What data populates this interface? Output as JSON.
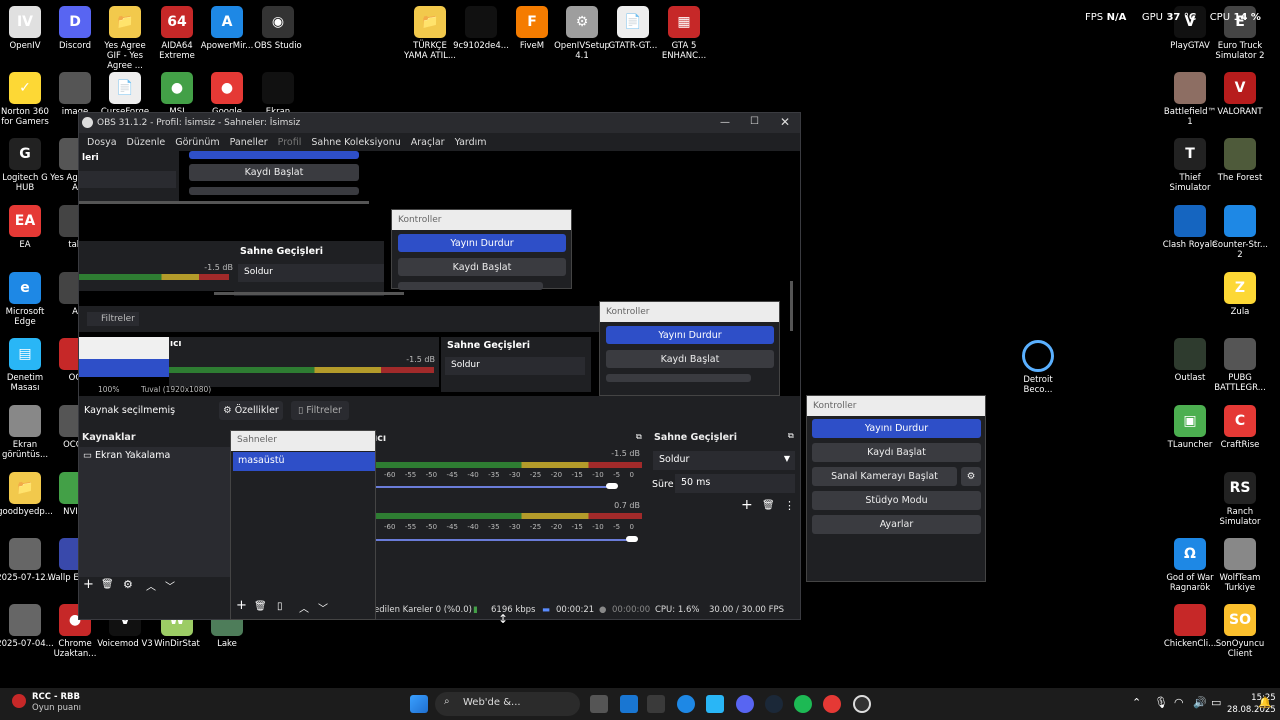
{
  "desktop_icons": [
    {
      "label": "OpenIV",
      "color": "#e0e0e0",
      "glyph": "IV"
    },
    {
      "label": "Discord",
      "color": "#5865f2",
      "glyph": "D"
    },
    {
      "label": "Yes Agree GIF - Yes Agree ...",
      "color": "#f2c94c",
      "glyph": "📁"
    },
    {
      "label": "AIDA64 Extreme",
      "color": "#c62828",
      "glyph": "64"
    },
    {
      "label": "ApowerMir...",
      "color": "#1e88e5",
      "glyph": "A"
    },
    {
      "label": "OBS Studio",
      "color": "#333",
      "glyph": "◉"
    },
    {
      "label": "TÜRKÇE YAMA ATIL...",
      "color": "#f2c94c",
      "glyph": "📁"
    },
    {
      "label": "9c9102de4...",
      "color": "#111",
      "glyph": ""
    },
    {
      "label": "FiveM",
      "color": "#f57c00",
      "glyph": "F"
    },
    {
      "label": "OpenIVSetup 4.1",
      "color": "#9e9e9e",
      "glyph": "⚙"
    },
    {
      "label": "GTATR-GT...",
      "color": "#eee",
      "glyph": "📄"
    },
    {
      "label": "GTA 5 ENHANC...",
      "color": "#c62828",
      "glyph": "▦"
    },
    {
      "label": "Norton 360 for Gamers",
      "color": "#fdd835",
      "glyph": "✓"
    },
    {
      "label": "image",
      "color": "#555",
      "glyph": ""
    },
    {
      "label": "CurseForge",
      "color": "#eee",
      "glyph": "📄"
    },
    {
      "label": "MSI",
      "color": "#43a047",
      "glyph": "●"
    },
    {
      "label": "Google",
      "color": "#e53935",
      "glyph": "●"
    },
    {
      "label": "Ekran",
      "color": "#111",
      "glyph": ""
    },
    {
      "label": "Logitech G HUB",
      "color": "#222",
      "glyph": "G"
    },
    {
      "label": "Yes Ag - Yes A",
      "color": "#555",
      "glyph": ""
    },
    {
      "label": "EA",
      "color": "#e53935",
      "glyph": "EA"
    },
    {
      "label": "tak",
      "color": "#444",
      "glyph": ""
    },
    {
      "label": "Microsoft Edge",
      "color": "#1e88e5",
      "glyph": "e"
    },
    {
      "label": "A",
      "color": "#444",
      "glyph": ""
    },
    {
      "label": "Denetim Masası",
      "color": "#29b6f6",
      "glyph": "▤"
    },
    {
      "label": "OC",
      "color": "#c62828",
      "glyph": ""
    },
    {
      "label": "Ekran görüntüs...",
      "color": "#888",
      "glyph": ""
    },
    {
      "label": "OCCT",
      "color": "#555",
      "glyph": ""
    },
    {
      "label": "goodbyedp...",
      "color": "#f2c94c",
      "glyph": "📁"
    },
    {
      "label": "NVIDI",
      "color": "#43a047",
      "glyph": ""
    },
    {
      "label": "2025-07-12...",
      "color": "#666",
      "glyph": ""
    },
    {
      "label": "Wallp Engine",
      "color": "#3949ab",
      "glyph": ""
    },
    {
      "label": "2025-07-04...",
      "color": "#666",
      "glyph": ""
    },
    {
      "label": "Chrome Uzaktan...",
      "color": "#c62828",
      "glyph": "●"
    },
    {
      "label": "Voicemod V3",
      "color": "#111",
      "glyph": "V"
    },
    {
      "label": "WinDirStat",
      "color": "#9ccc65",
      "glyph": "W"
    },
    {
      "label": "Lake",
      "color": "#4e7d5a",
      "glyph": ""
    }
  ],
  "right_icons": [
    {
      "label": "PlayGTAV",
      "color": "#111",
      "glyph": "V"
    },
    {
      "label": "Euro Truck Simulator 2",
      "color": "#444",
      "glyph": "E"
    },
    {
      "label": "Battlefield™ 1",
      "color": "#8d6e63",
      "glyph": ""
    },
    {
      "label": "VALORANT",
      "color": "#b71c1c",
      "glyph": "V"
    },
    {
      "label": "Thief Simulator",
      "color": "#222",
      "glyph": "T"
    },
    {
      "label": "The Forest",
      "color": "#4e5a3a",
      "glyph": ""
    },
    {
      "label": "Clash Royale",
      "color": "#1565c0",
      "glyph": ""
    },
    {
      "label": "Counter-Str... 2",
      "color": "#1e88e5",
      "glyph": ""
    },
    {
      "label": "Zula",
      "color": "#fdd835",
      "glyph": "Z"
    },
    {
      "label": "Outlast",
      "color": "#2e3b2e",
      "glyph": ""
    },
    {
      "label": "PUBG BATTLEGR...",
      "color": "#555",
      "glyph": ""
    },
    {
      "label": "TLauncher",
      "color": "#4caf50",
      "glyph": "▣"
    },
    {
      "label": "CraftRise",
      "color": "#e53935",
      "glyph": "C"
    },
    {
      "label": "Ranch Simulator",
      "color": "#222",
      "glyph": "RS"
    },
    {
      "label": "God of War Ragnarök",
      "color": "#1e88e5",
      "glyph": "Ω"
    },
    {
      "label": "WolfTeam Turkiye",
      "color": "#888",
      "glyph": ""
    },
    {
      "label": "ChickenCli...",
      "color": "#c62828",
      "glyph": ""
    },
    {
      "label": "SonOyuncu Client",
      "color": "#fbc02d",
      "glyph": "SO"
    }
  ],
  "detroit": {
    "label": "Detroit Beco..."
  },
  "overlay": {
    "fps_label": "FPS",
    "fps_value": "N/A",
    "gpu_label": "GPU",
    "gpu_value": "37 °C",
    "cpu_label": "CPU",
    "cpu_value": "14 %"
  },
  "obs": {
    "title": "OBS 31.1.2 - Profil: İsimsiz - Sahneler: İsimsiz",
    "menu": [
      "Dosya",
      "Düzenle",
      "Görünüm",
      "Paneller",
      "Profil",
      "Sahne Koleksiyonu",
      "Araçlar",
      "Yardım"
    ],
    "nested": {
      "stop_stream": "Yayını Durdur",
      "start_record": "Kaydı Başlat",
      "virtual_cam": "Sanal Kamerayı Başlat",
      "kontroller": "Kontroller",
      "transitions": "Sahne Geçişleri",
      "fade": "Soldur",
      "filters": "Filtreler",
      "db1": "-1.5 dB",
      "mixer_fragment": "ıcı",
      "zoom": "100%",
      "canvas": "Tuval (1920x1080)",
      "scenes_fragment": "leri"
    },
    "source_bar": {
      "no_source": "Kaynak seçilmemiş",
      "properties": "Özellikler",
      "filters": "Filtreler"
    },
    "sources": {
      "title": "Kaynaklar",
      "items": [
        "Ekran Yakalama"
      ]
    },
    "scenes": {
      "title": "Sahneler",
      "items": [
        "masaüstü"
      ]
    },
    "mixer": {
      "title_fragment": "ıcı",
      "track1_db": "-1.5 dB",
      "track2_db": "0.7 dB",
      "ticks": [
        "-60",
        "-55",
        "-50",
        "-45",
        "-40",
        "-35",
        "-30",
        "-25",
        "-20",
        "-15",
        "-10",
        "-5",
        "0"
      ]
    },
    "transitions": {
      "title": "Sahne Geçişleri",
      "fade": "Soldur",
      "duration_label": "Süre",
      "duration_value": "50 ms"
    },
    "status": {
      "dropped": "edilen Kareler 0 (%0.0)",
      "kbps": "6196 kbps",
      "stream_time": "00:00:21",
      "rec_time": "00:00:00",
      "cpu": "CPU: 1.6%",
      "fps": "30.00 / 30.00 FPS"
    }
  },
  "controls": {
    "title": "Kontroller",
    "stop_stream": "Yayını Durdur",
    "start_record": "Kaydı Başlat",
    "virtual_cam": "Sanal Kamerayı Başlat",
    "studio_mode": "Stüdyo Modu",
    "settings": "Ayarlar"
  },
  "taskbar": {
    "rcc_title": "RCC - RBB",
    "rcc_sub": "Oyun puanı",
    "search": "Web'de &...",
    "time": "15:25",
    "date": "28.08.2025"
  }
}
